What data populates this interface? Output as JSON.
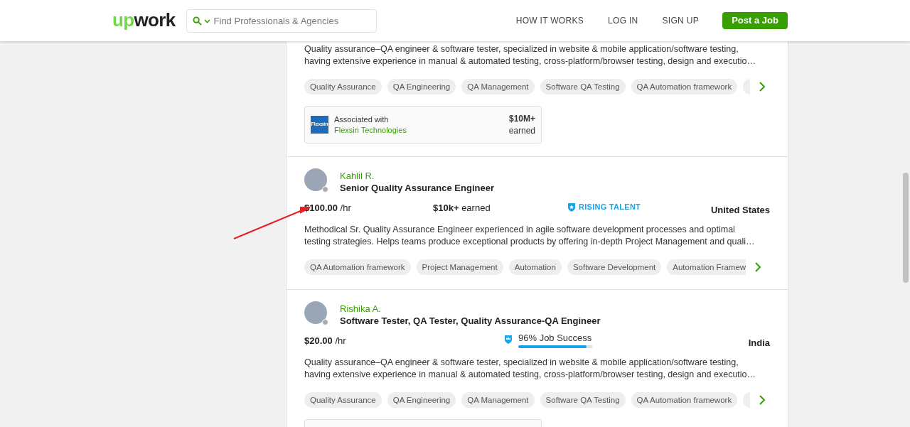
{
  "header": {
    "logo": {
      "accent": "up",
      "rest": "work"
    },
    "search": {
      "placeholder": "Find Professionals & Agencies"
    },
    "nav": [
      "HOW IT WORKS",
      "LOG IN",
      "SIGN UP"
    ],
    "cta": "Post a Job"
  },
  "freelancers": [
    {
      "description": "Quality assurance–QA engineer & software tester, specialized in website & mobile application/software testing, having extensive experience in manual & automated testing, cross-platform/browser testing, design and executio…",
      "skills": [
        "Quality Assurance",
        "QA Engineering",
        "QA Management",
        "Software QA Testing",
        "QA Automation framework"
      ],
      "more_skills": true,
      "agency": {
        "label": "Associated with",
        "name": "Flexsin Technologies",
        "logo": "Flexsin",
        "amount": "$10M+",
        "amount_label": "earned"
      }
    },
    {
      "name": "Kahlil R.",
      "online": false,
      "title": "Senior Quality Assurance Engineer",
      "rate": "**$100.00** /hr",
      "earned": "**$10k+** earned",
      "badge": {
        "kind": "rising_talent",
        "label": "RISING TALENT"
      },
      "country": "United States",
      "description": "Methodical Sr. Quality Assurance Engineer experienced in agile software development processes and optimal testing strategies. Helps teams produce exceptional products by offering in-depth Project Management and quali…",
      "skills": [
        "QA Automation framework",
        "Project Management",
        "Automation",
        "Software Development",
        "Automation Framew"
      ]
    },
    {
      "name": "Rishika A.",
      "online": false,
      "title": "Software Tester, QA Tester, Quality Assurance-QA Engineer",
      "rate": "**$20.00** /hr",
      "badge": {
        "kind": "job_success",
        "label": "96% Job Success",
        "level": 0.92
      },
      "country": "India",
      "description": "Quality assurance–QA engineer & software tester, specialized in website & mobile application/software testing, having extensive experience in manual & automated testing, cross-platform/browser testing, design and executio…",
      "skills": [
        "Quality Assurance",
        "QA Engineering",
        "QA Management",
        "Software QA Testing",
        "QA Automation framework"
      ],
      "more_skills": true,
      "agency_partial": true
    }
  ]
}
